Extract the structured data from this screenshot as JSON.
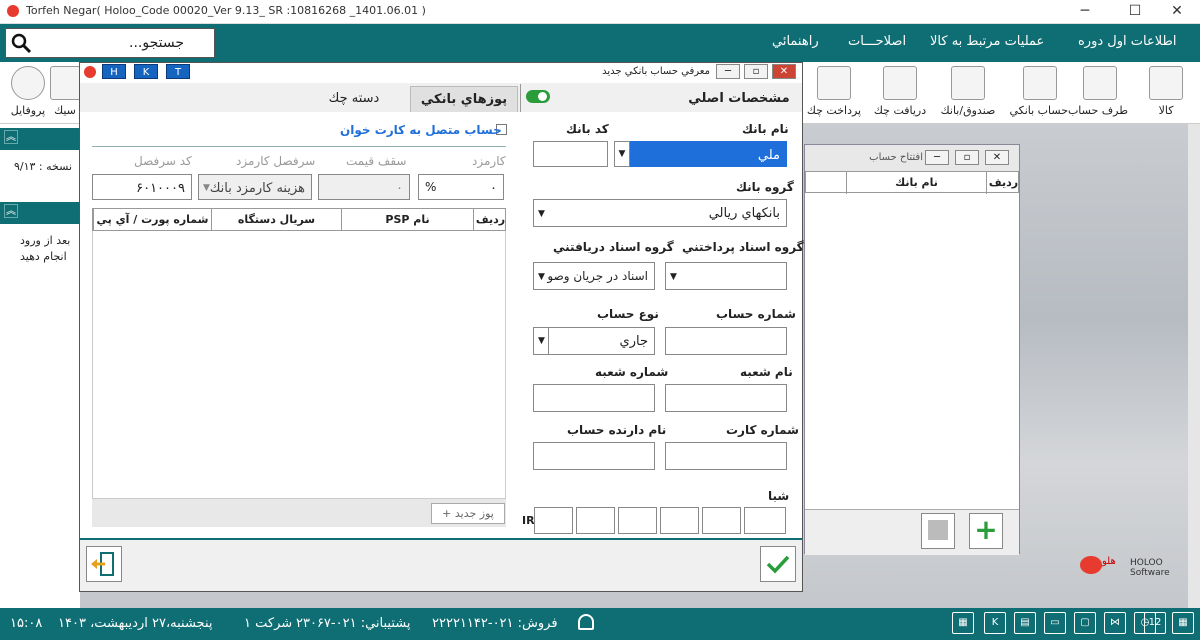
{
  "window": {
    "title": "Torfeh Negar( Holoo_Code  00020_Ver 9.13_ SR :10816268 _1401.06.01 )"
  },
  "search": {
    "placeholder": "جستجو..."
  },
  "menu": {
    "items": [
      "اطلاعات اول دوره",
      "عمليات مرتبط به كالا",
      "اصلاحـــات",
      "راهنمائي"
    ]
  },
  "toolbar": {
    "items": [
      "كالا",
      "طرف حساب",
      "حساب بانكي",
      "صندوق/بانك",
      "دريافت چك",
      "پرداخت چك"
    ],
    "left": [
      "پروفايل",
      "سيك"
    ]
  },
  "left_panel": {
    "version": "نسخه : ۹/۱۳",
    "msg1": "بعد از ورود",
    "msg2": "انجام دهيد"
  },
  "bg_window": {
    "title": "افتتاح حساب",
    "col_row": "رديف",
    "col_bank": "نام بانك"
  },
  "dialog": {
    "title": "معرفي حساب بانكي جديد",
    "hkt": [
      "H",
      "K",
      "T"
    ],
    "tabs": {
      "main": "مشخصات اصلي",
      "pos": "پوزهاي بانكي",
      "checkbook": "دسته چك"
    },
    "bank_name": {
      "label": "نام بانك",
      "value": "ملي"
    },
    "bank_code": {
      "label": "كد بانك",
      "value": ""
    },
    "bank_group": {
      "label": "گروه بانك",
      "value": "بانكهاي ريالي"
    },
    "pay_docs_group": {
      "label": "گروه اسناد پرداختني",
      "value": ""
    },
    "recv_docs_group": {
      "label": "گروه اسناد دريافتني",
      "value": "اسناد در جريان وصو"
    },
    "account_no": {
      "label": "شماره حساب",
      "value": ""
    },
    "account_type": {
      "label": "نوع حساب",
      "value": "جاري"
    },
    "branch_name": {
      "label": "نام شعبه",
      "value": ""
    },
    "branch_no": {
      "label": "شماره شعبه",
      "value": ""
    },
    "card_no": {
      "label": "شماره كارت",
      "value": ""
    },
    "holder_name": {
      "label": "نام دارنده حساب",
      "value": ""
    },
    "sheba": {
      "label": "شبا",
      "prefix": "IR"
    },
    "card_reader": {
      "label": "حساب متصل به كارت خوان"
    },
    "fee": {
      "label": "كارمزد",
      "value": "۰",
      "unit": "%"
    },
    "max_price": {
      "label": "سقف قيمت",
      "value": "۰"
    },
    "fee_heading": {
      "label": "سرفصل كارمزد",
      "value": "هزينه كارمزد بانك"
    },
    "heading_code": {
      "label": "كد سرفصل",
      "value": "۶۰۱۰۰۰۹"
    },
    "table": {
      "cols": [
        "رديف",
        "نام PSP",
        "سريال دستگاه",
        "شماره پورت / آي پي"
      ]
    },
    "new_pos": "پوز جديد"
  },
  "status": {
    "time": "۱۵:۰۸",
    "date": "پنجشنبه،۲۷ ارديبهشت، ۱۴۰۳",
    "company": "شركت ۱",
    "support": "پشتيباني: ۰۲۱-۲۳۰۶۷",
    "sales": "فروش: ۰۲۱-۲۲۲۲۱۱۴۲"
  },
  "brand": {
    "name": "هلو",
    "sub": "HOLOO Software"
  },
  "colors": {
    "teal": "#0f6e73",
    "selection": "#1e6fd9",
    "accent_green": "#2a9d3a"
  }
}
